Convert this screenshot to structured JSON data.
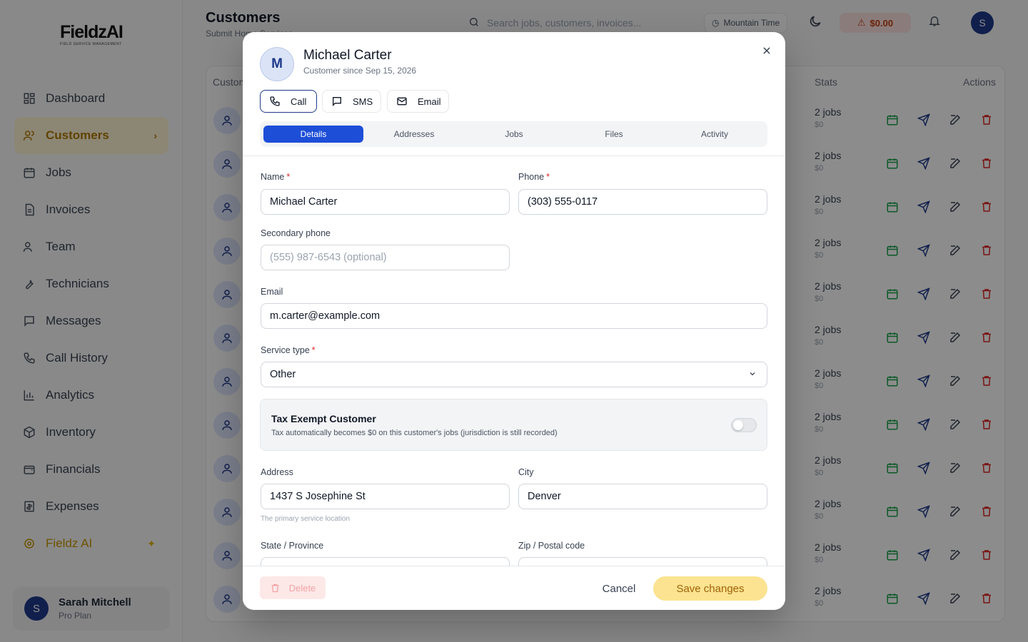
{
  "colors": {
    "primary": "#1d4ed8",
    "accent": "#f5c542",
    "danger": "#dc2626"
  },
  "sidebar": {
    "logo": "FieldzAI",
    "logo_sub": "FIELD SERVICE MANAGEMENT",
    "items": [
      {
        "label": "Dashboard",
        "icon": "grid-icon"
      },
      {
        "label": "Customers",
        "icon": "users-icon"
      },
      {
        "label": "Jobs",
        "icon": "calendar-icon"
      },
      {
        "label": "Invoices",
        "icon": "file-icon"
      },
      {
        "label": "Team",
        "icon": "team-icon"
      },
      {
        "label": "Technicians",
        "icon": "wrench-icon"
      },
      {
        "label": "Messages",
        "icon": "chat-icon"
      },
      {
        "label": "Call History",
        "icon": "phone-icon"
      },
      {
        "label": "Analytics",
        "icon": "bar-chart-icon"
      },
      {
        "label": "Inventory",
        "icon": "box-icon"
      },
      {
        "label": "Financials",
        "icon": "wallet-icon"
      },
      {
        "label": "Expenses",
        "icon": "receipt-icon"
      },
      {
        "label": "Fieldz AI",
        "icon": "ai-icon"
      }
    ],
    "user": {
      "initial": "S",
      "name": "Sarah Mitchell",
      "plan": "Pro Plan"
    }
  },
  "header": {
    "title": "Customers",
    "subtitle": "Submit Home Services",
    "search_placeholder": "Search jobs, customers, invoices...",
    "timezone": "Mountain Time",
    "balance": "$0.00",
    "avatar_initial": "S"
  },
  "table": {
    "col_customer": "Customer",
    "col_stats": "Stats",
    "col_actions": "Actions",
    "rows": [
      {
        "jobs": "2 jobs",
        "money": "$0"
      },
      {
        "jobs": "2 jobs",
        "money": "$0"
      },
      {
        "jobs": "2 jobs",
        "money": "$0"
      },
      {
        "jobs": "2 jobs",
        "money": "$0"
      },
      {
        "jobs": "2 jobs",
        "money": "$0"
      },
      {
        "jobs": "2 jobs",
        "money": "$0"
      },
      {
        "jobs": "2 jobs",
        "money": "$0"
      },
      {
        "jobs": "2 jobs",
        "money": "$0"
      },
      {
        "jobs": "2 jobs",
        "money": "$0"
      },
      {
        "jobs": "2 jobs",
        "money": "$0"
      },
      {
        "jobs": "2 jobs",
        "money": "$0"
      },
      {
        "jobs": "2 jobs",
        "money": "$0"
      }
    ]
  },
  "modal": {
    "avatar_initial": "M",
    "name": "Michael Carter",
    "since": "Customer since Sep 15, 2026",
    "actions": {
      "call": "Call",
      "sms": "SMS",
      "email": "Email"
    },
    "tabs": [
      "Details",
      "Addresses",
      "Jobs",
      "Files",
      "Activity"
    ],
    "form": {
      "name_label": "Name",
      "name_value": "Michael Carter",
      "phone_label": "Phone",
      "phone_value": "(303) 555-0117",
      "secondary_label": "Secondary phone",
      "secondary_placeholder": "(555) 987-6543 (optional)",
      "email_label": "Email",
      "email_value": "m.carter@example.com",
      "service_label": "Service type",
      "service_value": "Other",
      "tax_title": "Tax Exempt Customer",
      "tax_desc": "Tax automatically becomes $0 on this customer's jobs (jurisdiction is still recorded)",
      "tax_exempt": false,
      "address_label": "Address",
      "address_value": "1437 S Josephine St",
      "address_hint": "The primary service location",
      "city_label": "City",
      "city_value": "Denver",
      "state_label": "State / Province",
      "zip_label": "Zip / Postal code"
    },
    "footer": {
      "delete": "Delete",
      "cancel": "Cancel",
      "save": "Save changes"
    }
  }
}
